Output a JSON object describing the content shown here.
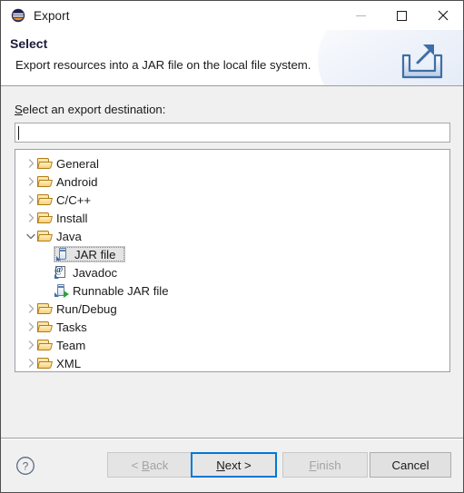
{
  "window": {
    "title": "Export",
    "icon": "eclipse-icon",
    "controls": {
      "minimize": "minimize-icon",
      "maximize": "maximize-icon",
      "close": "close-icon"
    }
  },
  "header": {
    "title": "Select",
    "description": "Export resources into a JAR file on the local file system.",
    "banner_icon": "export-arrow-icon"
  },
  "form": {
    "label_prefix": "S",
    "label_rest": "elect an export destination:",
    "filter_value": "",
    "filter_placeholder": ""
  },
  "tree": {
    "items": [
      {
        "label": "General",
        "level": 1,
        "icon": "folder-icon",
        "state": "collapsed",
        "selected": false
      },
      {
        "label": "Android",
        "level": 1,
        "icon": "folder-icon",
        "state": "collapsed",
        "selected": false
      },
      {
        "label": "C/C++",
        "level": 1,
        "icon": "folder-icon",
        "state": "collapsed",
        "selected": false
      },
      {
        "label": "Install",
        "level": 1,
        "icon": "folder-icon",
        "state": "collapsed",
        "selected": false
      },
      {
        "label": "Java",
        "level": 1,
        "icon": "folder-icon",
        "state": "expanded",
        "selected": false
      },
      {
        "label": "JAR file",
        "level": 2,
        "icon": "jar-icon",
        "state": "leaf",
        "selected": true
      },
      {
        "label": "Javadoc",
        "level": 2,
        "icon": "javadoc-icon",
        "state": "leaf",
        "selected": false
      },
      {
        "label": "Runnable JAR file",
        "level": 2,
        "icon": "runnable-jar-icon",
        "state": "leaf",
        "selected": false
      },
      {
        "label": "Run/Debug",
        "level": 1,
        "icon": "folder-icon",
        "state": "collapsed",
        "selected": false
      },
      {
        "label": "Tasks",
        "level": 1,
        "icon": "folder-icon",
        "state": "collapsed",
        "selected": false
      },
      {
        "label": "Team",
        "level": 1,
        "icon": "folder-icon",
        "state": "collapsed",
        "selected": false
      },
      {
        "label": "XML",
        "level": 1,
        "icon": "folder-icon",
        "state": "collapsed",
        "selected": false
      }
    ]
  },
  "footer": {
    "help_icon": "help-icon",
    "buttons": [
      {
        "id": "back",
        "label": "< Back",
        "mnemonic": "B",
        "enabled": false,
        "default": false
      },
      {
        "id": "next",
        "label": "Next >",
        "mnemonic": "N",
        "enabled": true,
        "default": true
      },
      {
        "id": "finish",
        "label": "Finish",
        "mnemonic": "F",
        "enabled": false,
        "default": false
      },
      {
        "id": "cancel",
        "label": "Cancel",
        "mnemonic": "",
        "enabled": true,
        "default": false
      }
    ]
  },
  "colors": {
    "accent_blue": "#0078d7",
    "dialog_bg": "#f0f0f0",
    "panel_bg": "#ffffff",
    "selection_bg": "#e4e4e4",
    "disabled_text": "#a3a3a3",
    "folder_gold": "#f7d077"
  }
}
